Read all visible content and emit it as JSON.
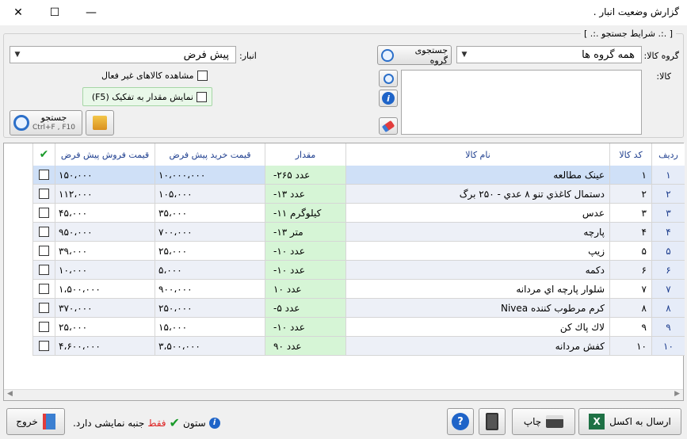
{
  "window": {
    "title": "گزارش وضعیت انبار ."
  },
  "search": {
    "legend": "[ .:. شرایط جستجو .:. ]",
    "group_label": "گروه کالا:",
    "group_value": "همه گروه ها",
    "group_search_button": "جستجوی گروه",
    "warehouse_label": "انبار:",
    "warehouse_value": "پیش فرض",
    "item_label": "کالا:",
    "show_inactive_label": "مشاهده کالاهای غیر فعال",
    "show_separate_label": "نمایش مقدار به تفکیک (F5)",
    "search_button_label": "جستجو",
    "search_button_shortcut": "Ctrl+F , F10"
  },
  "grid": {
    "columns": {
      "row": "ردیف",
      "code": "کد کالا",
      "name": "نام کالا",
      "qty": "مقدار",
      "buy": "قیمت خرید پیش فرض",
      "sell": "قیمت فروش پیش فرض",
      "check": "✔"
    },
    "rows": [
      {
        "row": "۱",
        "code": "۱",
        "name": "عینک مطالعه",
        "qty": "-۲۶۵ عدد",
        "buy": "۱۰،۰۰۰،۰۰۰",
        "sell": "۱۵۰،۰۰۰"
      },
      {
        "row": "۲",
        "code": "۲",
        "name": "دستمال کاغذي تنو ۸ عدي - ۲۵۰ برگ",
        "qty": "-۱۳ عدد",
        "buy": "۱۰۵،۰۰۰",
        "sell": "۱۱۲،۰۰۰"
      },
      {
        "row": "۳",
        "code": "۳",
        "name": "عدس",
        "qty": "-۱۱ کیلوگرم",
        "buy": "۳۵،۰۰۰",
        "sell": "۴۵،۰۰۰"
      },
      {
        "row": "۴",
        "code": "۴",
        "name": "پارچه",
        "qty": "-۱۳ متر",
        "buy": "۷۰۰،۰۰۰",
        "sell": "۹۵۰،۰۰۰"
      },
      {
        "row": "۵",
        "code": "۵",
        "name": "زیپ",
        "qty": "-۱۰ عدد",
        "buy": "۲۵،۰۰۰",
        "sell": "۳۹،۰۰۰"
      },
      {
        "row": "۶",
        "code": "۶",
        "name": "دکمه",
        "qty": "-۱۰ عدد",
        "buy": "۵،۰۰۰",
        "sell": "۱۰،۰۰۰"
      },
      {
        "row": "۷",
        "code": "۷",
        "name": "شلوار پارچه اي مردانه",
        "qty": "۱۰ عدد",
        "buy": "۹۰۰،۰۰۰",
        "sell": "۱،۵۰۰،۰۰۰"
      },
      {
        "row": "۸",
        "code": "۸",
        "name": "کرم مرطوب کننده Nivea",
        "qty": "-۵ عدد",
        "buy": "۲۵۰،۰۰۰",
        "sell": "۳۷۰،۰۰۰"
      },
      {
        "row": "۹",
        "code": "۹",
        "name": "لاك پاك كن",
        "qty": "-۱۰ عدد",
        "buy": "۱۵،۰۰۰",
        "sell": "۲۵،۰۰۰"
      },
      {
        "row": "۱۰",
        "code": "۱۰",
        "name": "کفش مردانه",
        "qty": "۹۰ عدد",
        "buy": "۳،۵۰۰،۰۰۰",
        "sell": "۴،۶۰۰،۰۰۰"
      }
    ]
  },
  "footer": {
    "excel_label": "ارسال به اکسل",
    "print_label": "چاپ",
    "exit_label": "خروج",
    "info_col": "ستون",
    "info_only": "فقط",
    "info_rest": "جنبه نمایشی دارد."
  }
}
